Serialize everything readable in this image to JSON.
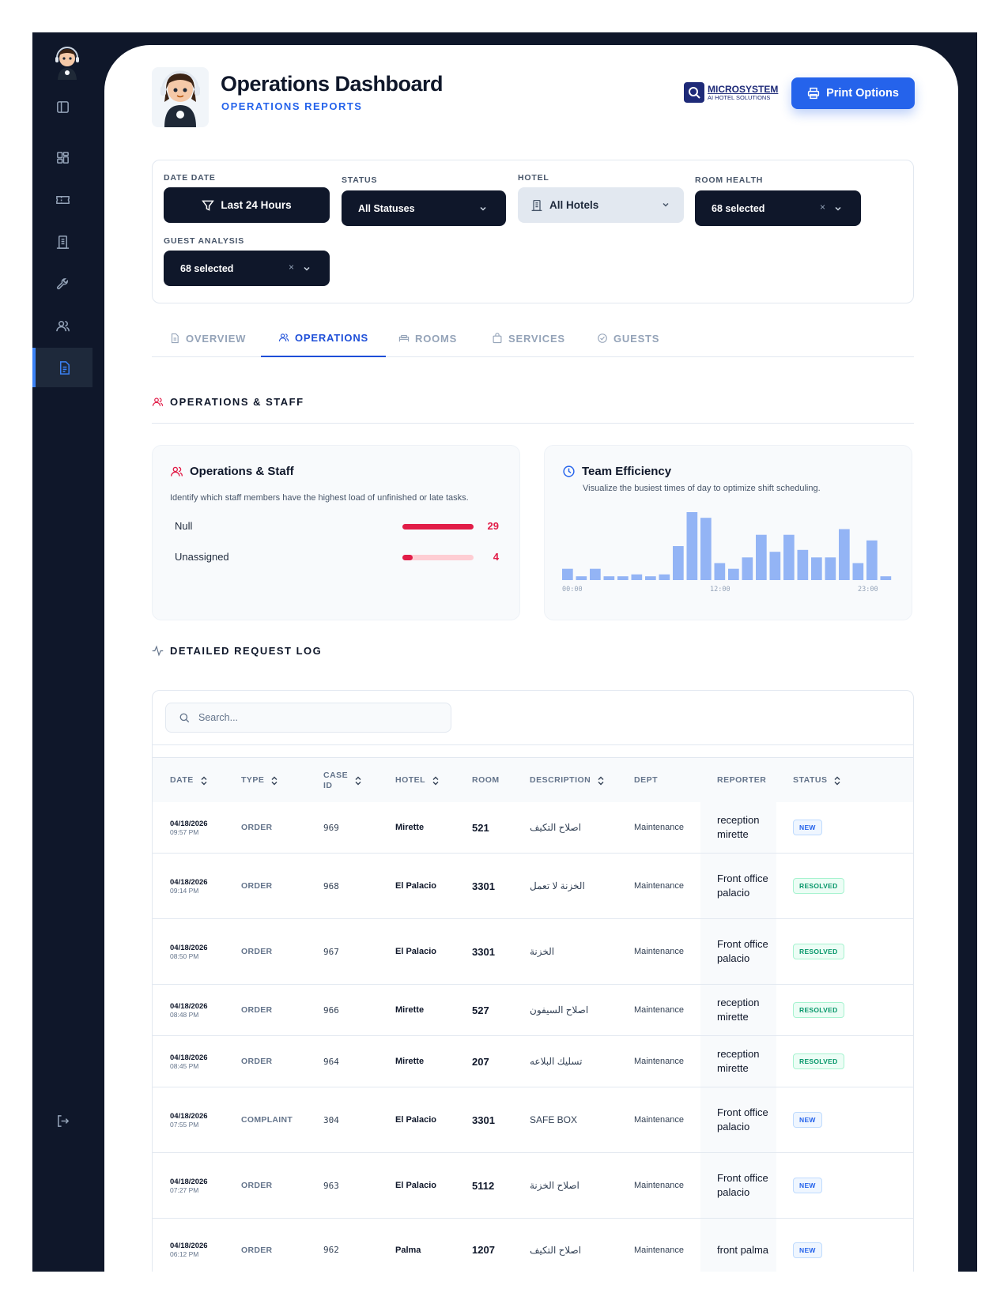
{
  "header": {
    "title": "Operations Dashboard",
    "subtitle": "OPERATIONS REPORTS",
    "brand_name": "MICROSYSTEM",
    "brand_tagline": "AI HOTEL SOLUTIONS",
    "print_label": "Print Options"
  },
  "filters": {
    "date": {
      "label": "DATE DATE",
      "value": "Last 24 Hours"
    },
    "status": {
      "label": "STATUS",
      "value": "All Statuses"
    },
    "hotel": {
      "label": "HOTEL",
      "value": "All Hotels"
    },
    "room_health": {
      "label": "ROOM HEALTH",
      "value": "68 selected"
    },
    "guest_analysis": {
      "label": "GUEST ANALYSIS",
      "value": "68 selected"
    }
  },
  "tabs": [
    {
      "label": "OVERVIEW",
      "icon": "document-icon"
    },
    {
      "label": "OPERATIONS",
      "icon": "users-icon",
      "active": true
    },
    {
      "label": "ROOMS",
      "icon": "bed-icon"
    },
    {
      "label": "SERVICES",
      "icon": "bag-icon"
    },
    {
      "label": "GUESTS",
      "icon": "check-circle-icon"
    }
  ],
  "section_ops": {
    "title": "OPERATIONS & STAFF"
  },
  "staff_card": {
    "title": "Operations & Staff",
    "description": "Identify which staff members have the highest load of unfinished or late tasks.",
    "rows": [
      {
        "label": "Null",
        "value": "29",
        "fraction": 1.0
      },
      {
        "label": "Unassigned",
        "value": "4",
        "fraction": 0.14
      }
    ]
  },
  "efficiency_card": {
    "title": "Team Efficiency",
    "description": "Visualize the busiest times of day to optimize shift scheduling."
  },
  "chart_data": {
    "type": "bar",
    "title": "Team Efficiency",
    "x": [
      "00:00",
      "01:00",
      "02:00",
      "03:00",
      "04:00",
      "05:00",
      "06:00",
      "07:00",
      "08:00",
      "09:00",
      "10:00",
      "11:00",
      "12:00",
      "13:00",
      "14:00",
      "15:00",
      "16:00",
      "17:00",
      "18:00",
      "19:00",
      "20:00",
      "21:00",
      "22:00",
      "23:00"
    ],
    "values": [
      3,
      1,
      3,
      1,
      1,
      1.5,
      1,
      1.5,
      9,
      18,
      16.5,
      4.5,
      3,
      6,
      12,
      7.5,
      12,
      8,
      6,
      6,
      13.5,
      4.5,
      10.5,
      1
    ],
    "tick_labels": [
      "00:00",
      "12:00",
      "23:00"
    ],
    "color": "#93b4f5"
  },
  "section_log": {
    "title": "DETAILED REQUEST LOG"
  },
  "log": {
    "search_placeholder": "Search...",
    "columns": [
      "DATE",
      "TYPE",
      "CASE\nID",
      "HOTEL",
      "ROOM",
      "DESCRIPTION",
      "DEPT",
      "REPORTER",
      "STATUS"
    ],
    "rows": [
      {
        "date": "04/18/2026",
        "time": "09:57 PM",
        "type": "ORDER",
        "case": "969",
        "hotel": "Mirette",
        "room": "521",
        "desc": "اصلاح التكيف",
        "dept": "Maintenance",
        "reporter": "reception mirette",
        "status": "NEW"
      },
      {
        "date": "04/18/2026",
        "time": "09:14 PM",
        "type": "ORDER",
        "case": "968",
        "hotel": "El Palacio",
        "room": "3301",
        "desc": "الخزنة لا تعمل",
        "dept": "Maintenance",
        "reporter": "Front office palacio",
        "status": "RESOLVED"
      },
      {
        "date": "04/18/2026",
        "time": "08:50 PM",
        "type": "ORDER",
        "case": "967",
        "hotel": "El Palacio",
        "room": "3301",
        "desc": "الخزنة",
        "dept": "Maintenance",
        "reporter": "Front office palacio",
        "status": "RESOLVED"
      },
      {
        "date": "04/18/2026",
        "time": "08:48 PM",
        "type": "ORDER",
        "case": "966",
        "hotel": "Mirette",
        "room": "527",
        "desc": "اصلاح السيفون",
        "dept": "Maintenance",
        "reporter": "reception mirette",
        "status": "RESOLVED"
      },
      {
        "date": "04/18/2026",
        "time": "08:45 PM",
        "type": "ORDER",
        "case": "964",
        "hotel": "Mirette",
        "room": "207",
        "desc": "تسليك البلاعه",
        "dept": "Maintenance",
        "reporter": "reception mirette",
        "status": "RESOLVED"
      },
      {
        "date": "04/18/2026",
        "time": "07:55 PM",
        "type": "COMPLAINT",
        "case": "304",
        "hotel": "El Palacio",
        "room": "3301",
        "desc": "SAFE BOX",
        "dept": "Maintenance",
        "reporter": "Front office palacio",
        "status": "NEW"
      },
      {
        "date": "04/18/2026",
        "time": "07:27 PM",
        "type": "ORDER",
        "case": "963",
        "hotel": "El Palacio",
        "room": "5112",
        "desc": "اصلاح الخزنة",
        "dept": "Maintenance",
        "reporter": "Front office palacio",
        "status": "NEW"
      },
      {
        "date": "04/18/2026",
        "time": "06:12 PM",
        "type": "ORDER",
        "case": "962",
        "hotel": "Palma",
        "room": "1207",
        "desc": "اصلاح التكيف",
        "dept": "Maintenance",
        "reporter": "front palma",
        "status": "NEW"
      }
    ]
  },
  "sidebar": {
    "items": [
      "panel-icon",
      "grid-icon",
      "ticket-icon",
      "building-icon",
      "wrench-icon",
      "users-icon",
      "report-icon"
    ],
    "active": "report-icon",
    "footer": "logout-icon"
  },
  "colors": {
    "accent": "#2563eb",
    "sidebar": "#0f172a",
    "danger": "#e11d48",
    "success": "#059669"
  }
}
